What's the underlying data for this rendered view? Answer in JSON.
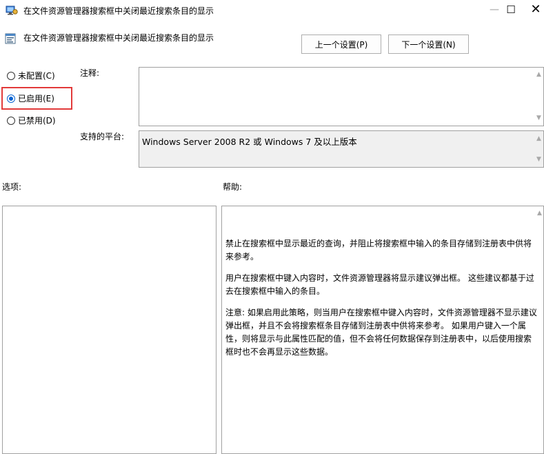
{
  "window": {
    "title": "在文件资源管理器搜索框中关闭最近搜索条目的显示",
    "minimize_glyph": "—",
    "maximize_glyph": "☐",
    "close_glyph": "✕"
  },
  "header": {
    "title": "在文件资源管理器搜索框中关闭最近搜索条目的显示",
    "prev_button": "上一个设置(P)",
    "next_button": "下一个设置(N)"
  },
  "state": {
    "options": [
      {
        "label": "未配置(C)",
        "checked": false
      },
      {
        "label": "已启用(E)",
        "checked": true
      },
      {
        "label": "已禁用(D)",
        "checked": false
      }
    ]
  },
  "comment": {
    "label": "注释:",
    "value": ""
  },
  "platform": {
    "label": "支持的平台:",
    "value": "Windows Server 2008 R2 或 Windows 7 及以上版本"
  },
  "options_section": {
    "label": "选项:"
  },
  "help_section": {
    "label": "帮助:",
    "paragraphs": [
      "禁止在搜索框中显示最近的查询，并阻止将搜索框中输入的条目存储到注册表中供将来参考。",
      "用户在搜索框中键入内容时，文件资源管理器将显示建议弹出框。 这些建议都基于过去在搜索框中输入的条目。",
      "注意: 如果启用此策略，则当用户在搜索框中键入内容时，文件资源管理器不显示建议弹出框，并且不会将搜索框条目存储到注册表中供将来参考。 如果用户键入一个属性，则将显示与此属性匹配的值，但不会将任何数据保存到注册表中，以后使用搜索框时也不会再显示这些数据。"
    ]
  },
  "colors": {
    "accent": "#0a64d2",
    "highlight": "#e23a3a",
    "border": "#a0a0a0"
  }
}
